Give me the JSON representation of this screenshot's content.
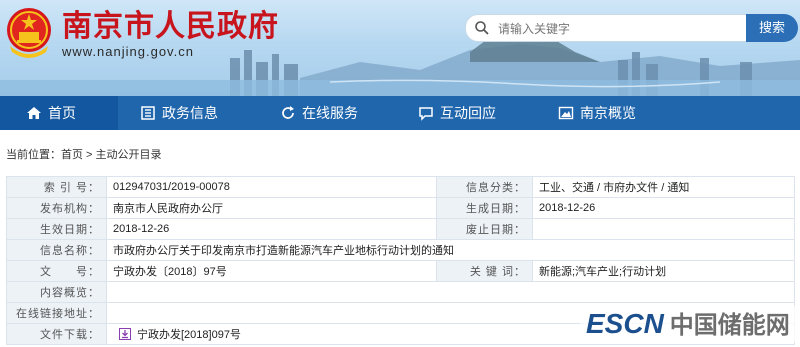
{
  "header": {
    "title": "南京市人民政府",
    "url": "www.nanjing.gov.cn",
    "search_placeholder": "请输入关键字",
    "search_button": "搜索"
  },
  "nav": {
    "items": [
      {
        "label": "首页",
        "icon": "home-icon"
      },
      {
        "label": "政务信息",
        "icon": "building-icon"
      },
      {
        "label": "在线服务",
        "icon": "refresh-icon"
      },
      {
        "label": "互动回应",
        "icon": "chat-icon"
      },
      {
        "label": "南京概览",
        "icon": "mountain-icon"
      }
    ]
  },
  "breadcrumb": {
    "prefix": "当前位置：",
    "home": "首页",
    "sep": " > ",
    "current": "主动公开目录"
  },
  "info": {
    "index_label": "索 引 号：",
    "index_value": "012947031/2019-00078",
    "category_label": "信息分类：",
    "category_value": "工业、交通 / 市府办文件 / 通知",
    "issuer_label": "发布机构：",
    "issuer_value": "南京市人民政府办公厅",
    "created_label": "生成日期：",
    "created_value": "2018-12-26",
    "effective_label": "生效日期：",
    "effective_value": "2018-12-26",
    "repeal_label": "废止日期：",
    "repeal_value": "",
    "name_label": "信息名称：",
    "name_value": "市政府办公厅关于印发南京市打造新能源汽车产业地标行动计划的通知",
    "docno_label": "文　　号：",
    "docno_value": "宁政办发〔2018〕97号",
    "keywords_label": "关 键 词：",
    "keywords_value": "新能源;汽车产业;行动计划",
    "summary_label": "内容概览：",
    "summary_value": "",
    "link_label": "在线链接地址：",
    "link_value": "",
    "download_label": "文件下载：",
    "download_value": "宁政办发[2018]097号"
  },
  "watermark": {
    "brand": "ESCN",
    "name": "中国储能网"
  },
  "colors": {
    "title_red": "#c8141d",
    "nav_blue": "#1f66ad",
    "search_blue": "#2c6fb6",
    "label_bg": "#edf2f7"
  }
}
